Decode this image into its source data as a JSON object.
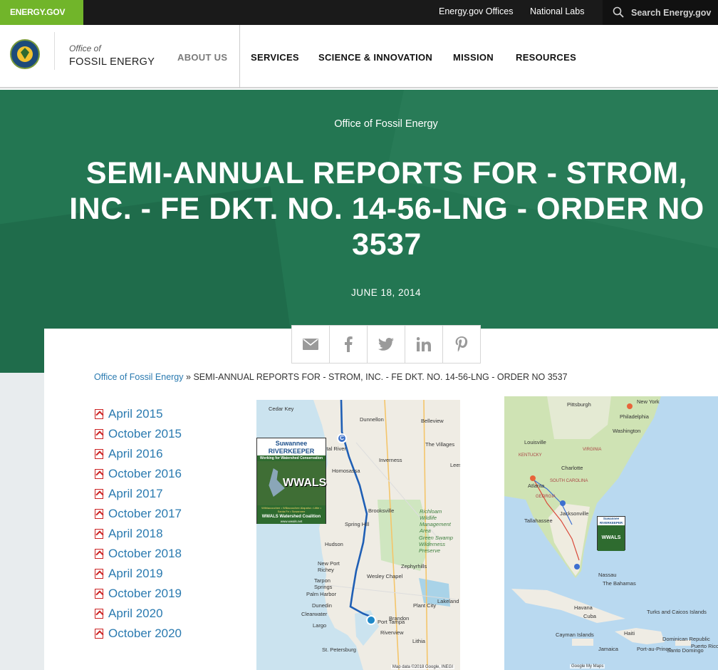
{
  "topbar": {
    "brand": "ENERGY.GOV",
    "links": [
      "Energy.gov Offices",
      "National Labs"
    ],
    "search_placeholder": "Search Energy.gov"
  },
  "header": {
    "office_of": "Office of",
    "office_name": "FOSSIL ENERGY",
    "nav": [
      "ABOUT US",
      "SERVICES",
      "SCIENCE & INNOVATION",
      "MISSION",
      "RESOURCES"
    ]
  },
  "hero": {
    "kicker": "Office of Fossil Energy",
    "title": "SEMI-ANNUAL REPORTS FOR - STROM, INC. - FE DKT. NO. 14-56-LNG - ORDER NO 3537",
    "date": "JUNE 18, 2014",
    "color": "#237652"
  },
  "share": {
    "icons": [
      "email-icon",
      "facebook-icon",
      "twitter-icon",
      "linkedin-icon",
      "pinterest-icon"
    ]
  },
  "breadcrumb": {
    "home": "Office of Fossil Energy",
    "separator": "»",
    "current": "SEMI-ANNUAL REPORTS FOR - STROM, INC. - FE DKT. NO. 14-56-LNG - ORDER NO 3537"
  },
  "reports": [
    "April 2015",
    "October 2015",
    "April 2016",
    "October 2016",
    "April 2017",
    "October 2017",
    "April 2018",
    "October 2018",
    "April 2019",
    "October 2019",
    "April 2020",
    "October 2020"
  ],
  "map1": {
    "labels": {
      "cedar_key": "Cedar Key",
      "dunnellon": "Dunnellon",
      "belleview": "Belleview",
      "crystal_river": "Crystal River",
      "inverness": "Inverness",
      "the_villages": "The Villages",
      "leesburg": "Lees",
      "homosassa": "Homosassa",
      "brooksville": "Brooksville",
      "spring_hill": "Spring Hill",
      "richloam": "Richloam Wildlife Management Area",
      "green_swamp": "Green Swamp Wilderness Preserve",
      "hudson": "Hudson",
      "new_port_richey": "New Port Richey",
      "zephyrhills": "Zephyrhills",
      "wesley_chapel": "Wesley Chapel",
      "tarpon_springs": "Tarpon Springs",
      "palm_harbor": "Palm Harbor",
      "dunedin": "Dunedin",
      "plant_city": "Plant City",
      "lakeland": "Lakeland",
      "clearwater": "Clearwater",
      "largo": "Largo",
      "brandon": "Brandon",
      "port_tampa": "Port Tampa",
      "riverview": "Riverview",
      "lithia": "Lithia",
      "st_petersburg": "St. Petersburg"
    },
    "attribution": "Map data ©2018 Google, INEGI",
    "logo": {
      "title": "Suwannee RIVERKEEPER",
      "tagline": "Working for Watershed Conservation",
      "wwals": "WWALS",
      "rivers": "Withlacoochee • Willacoochee Alapaha • Little • Santa Fe • Suwannee",
      "coalition": "WWALS Watershed Coalition",
      "url": "www.wwals.net"
    }
  },
  "map2": {
    "labels": {
      "pittsburgh": "Pittsburgh",
      "new_york": "New York",
      "philadelphia": "Philadelphia",
      "washington": "Washington",
      "louisville": "Louisville",
      "virginia": "VIRGINIA",
      "kentucky": "KENTUCKY",
      "charlotte": "Charlotte",
      "atlanta": "Atlanta",
      "south_carolina": "SOUTH CAROLINA",
      "georgia": "GEORGIA",
      "tallahassee": "Tallahassee",
      "jacksonville": "Jacksonville",
      "cuba": "Cuba",
      "havana": "Havana",
      "bahamas": "The Bahamas",
      "nassau": "Nassau",
      "dominican_republic": "Dominican Republic",
      "haiti": "Haiti",
      "jamaica": "Jamaica",
      "puerto_rico": "Puerto Rico",
      "turks_caicos": "Turks and Caicos Islands",
      "cayman": "Cayman Islands",
      "santo_domingo": "Santo Domingo",
      "port_au_prince": "Port-au-Prince"
    },
    "attribution": "Google My Maps",
    "logo_title": "Suwannee RIVERKEEPER",
    "logo_band": "WWALS"
  }
}
